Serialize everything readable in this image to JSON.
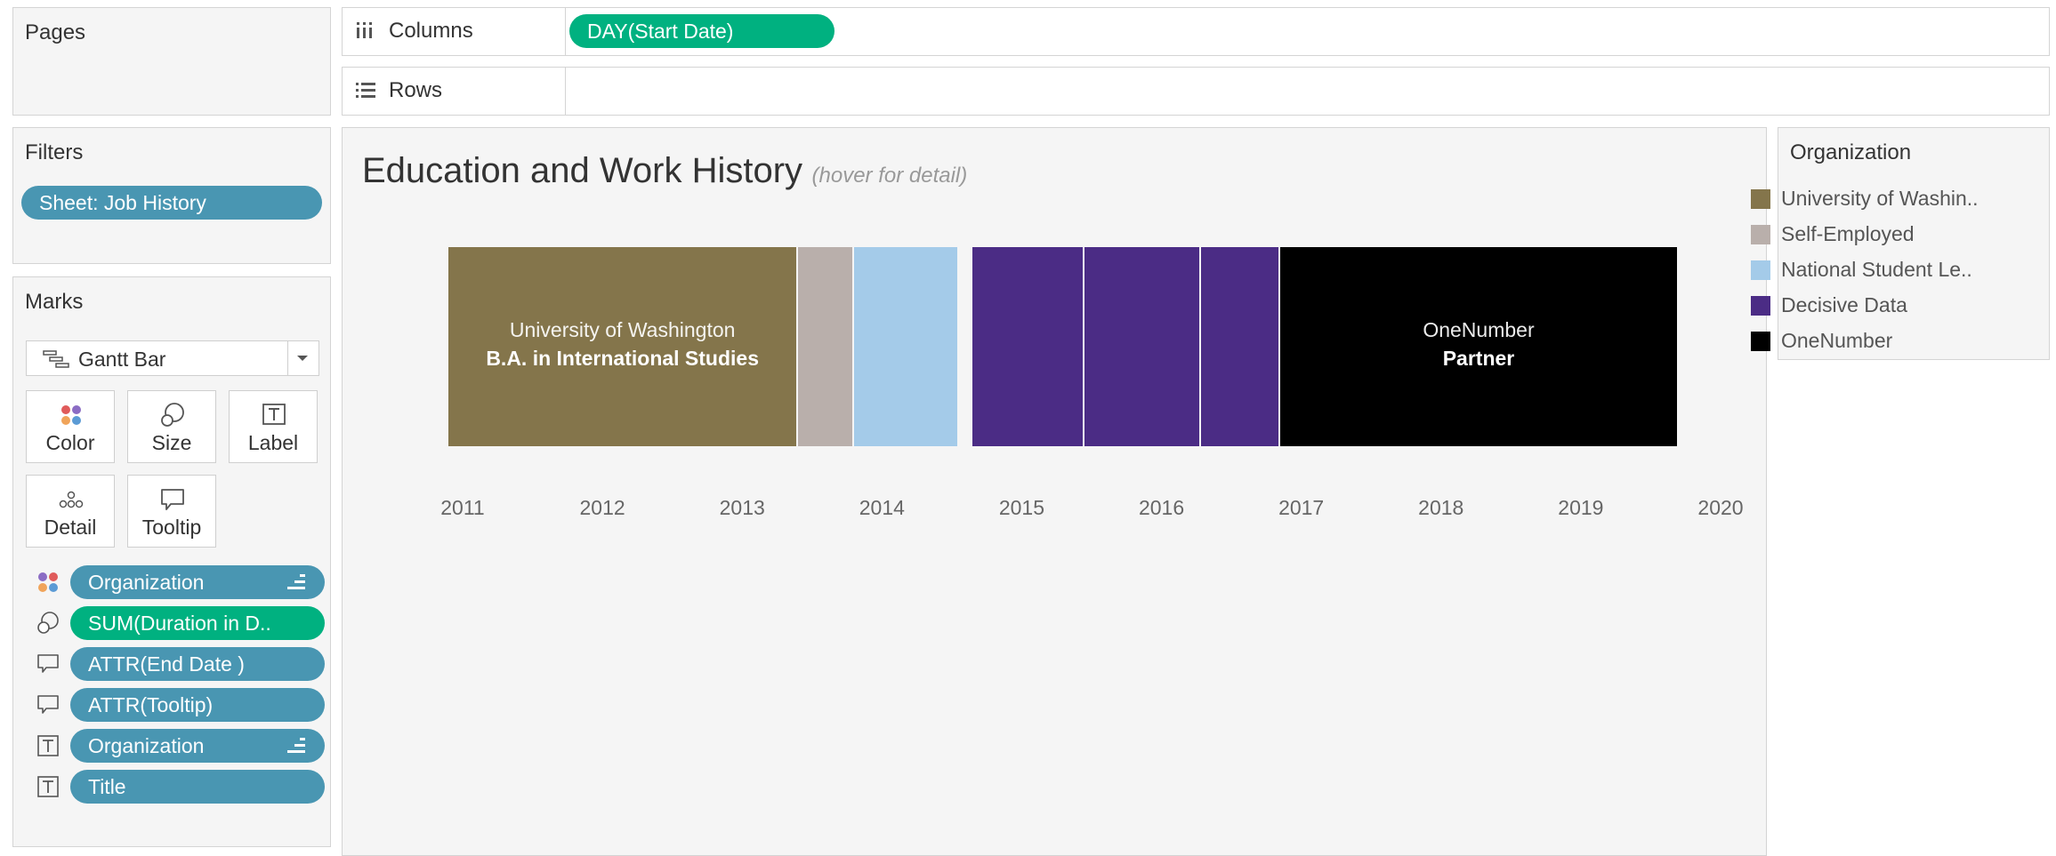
{
  "pages": {
    "title": "Pages"
  },
  "filters": {
    "title": "Filters",
    "pills": [
      "Sheet: Job History"
    ]
  },
  "marks": {
    "title": "Marks",
    "mark_type": "Gantt Bar",
    "buttons": [
      "Color",
      "Size",
      "Label",
      "Detail",
      "Tooltip"
    ],
    "fields": [
      {
        "label": "Organization",
        "kind": "color",
        "style": "blue",
        "sorted": true
      },
      {
        "label": "SUM(Duration in D..",
        "kind": "size",
        "style": "green",
        "sorted": false
      },
      {
        "label": "ATTR(End Date )",
        "kind": "tooltip",
        "style": "blue",
        "sorted": false
      },
      {
        "label": "ATTR(Tooltip)",
        "kind": "tooltip",
        "style": "blue",
        "sorted": false
      },
      {
        "label": "Organization",
        "kind": "label",
        "style": "blue",
        "sorted": true
      },
      {
        "label": "Title",
        "kind": "label",
        "style": "blue",
        "sorted": false
      }
    ]
  },
  "shelves": {
    "columns_label": "Columns",
    "columns_pill": "DAY(Start Date)",
    "rows_label": "Rows"
  },
  "sheet": {
    "title": "Education and Work History",
    "subtitle": "(hover for detail)"
  },
  "legend": {
    "title": "Organization",
    "items": [
      {
        "label": "University of Washin..",
        "color": "#84754b"
      },
      {
        "label": "Self-Employed",
        "color": "#b9afab"
      },
      {
        "label": "National Student Le..",
        "color": "#a4cbe9"
      },
      {
        "label": "Decisive Data",
        "color": "#4b2c85"
      },
      {
        "label": "OneNumber",
        "color": "#000000"
      }
    ]
  },
  "chart_data": {
    "type": "bar",
    "x_ticks": [
      "2011",
      "2012",
      "2013",
      "2014",
      "2015",
      "2016",
      "2017",
      "2018",
      "2019",
      "2020"
    ],
    "xlim": [
      2010.7,
      2020.1
    ],
    "bars": [
      {
        "organization": "University of Washington",
        "start": 2010.9,
        "end": 2013.4,
        "color": "#84754b",
        "line1": "University of Washington",
        "line2": "B.A. in International Studies"
      },
      {
        "organization": "Self-Employed",
        "start": 2013.4,
        "end": 2013.8,
        "color": "#b9afab",
        "line1": "",
        "line2": ""
      },
      {
        "organization": "National Student Le..",
        "start": 2013.8,
        "end": 2014.55,
        "color": "#a4cbe9",
        "line1": "",
        "line2": ""
      },
      {
        "organization": "Decisive Data",
        "start": 2014.65,
        "end": 2015.45,
        "color": "#4b2c85",
        "line1": "",
        "line2": ""
      },
      {
        "organization": "Decisive Data",
        "start": 2015.45,
        "end": 2016.28,
        "color": "#4b2c85",
        "line1": "",
        "line2": ""
      },
      {
        "organization": "Decisive Data",
        "start": 2016.28,
        "end": 2016.85,
        "color": "#4b2c85",
        "line1": "",
        "line2": ""
      },
      {
        "organization": "OneNumber",
        "start": 2016.85,
        "end": 2019.7,
        "color": "#000000",
        "line1": "OneNumber",
        "line2": "Partner"
      }
    ]
  }
}
